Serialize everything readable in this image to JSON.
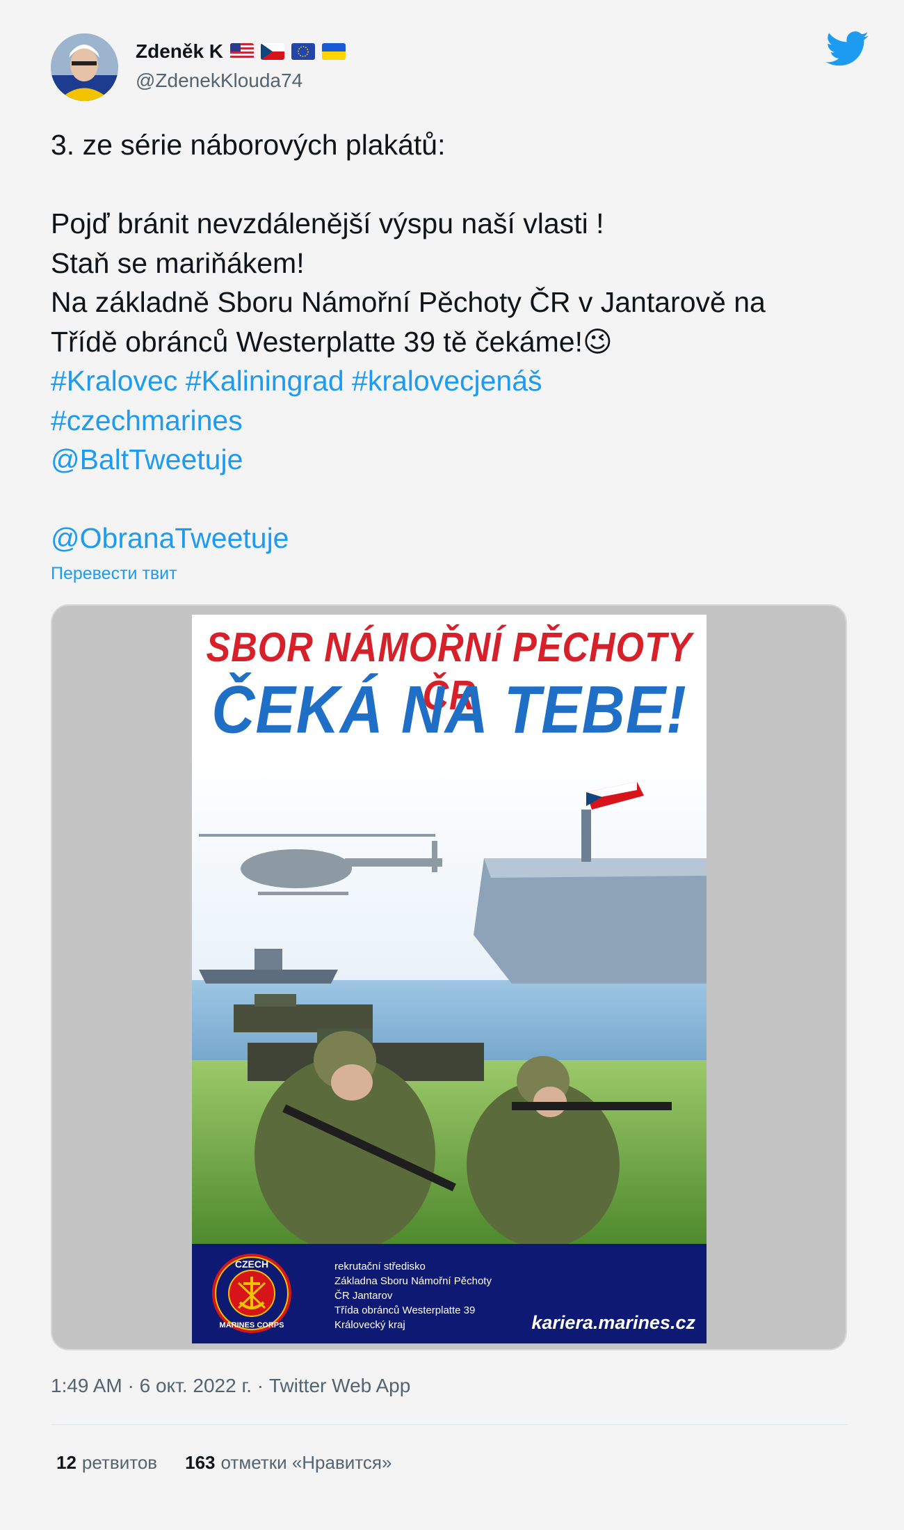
{
  "author": {
    "name": "Zdeněk K",
    "handle": "@ZdenekKlouda74",
    "flags": [
      "us-flag",
      "cz-flag",
      "eu-flag",
      "ua-flag"
    ]
  },
  "tweet": {
    "lines": [
      {
        "text": "3. ze série náborových plakátů:",
        "link": false
      },
      {
        "blank": true
      },
      {
        "text": "Pojď bránit nevzdálenější výspu naší vlasti !",
        "link": false
      },
      {
        "text": "Staň se mariňákem!",
        "link": false
      },
      {
        "text": "Na základně Sboru Námořní Pěchoty ČR v Jantarově na",
        "link": false
      },
      {
        "text": "Třídě obránců Westerplatte 39 tě čekáme!",
        "link": false,
        "emoji": "😉"
      },
      {
        "text": "#Kralovec  #Kaliningrad #kralovecjenáš",
        "link": true
      },
      {
        "text": "#czechmarines",
        "link": true
      },
      {
        "text": "@BaltTweetuje",
        "link": true
      },
      {
        "blank": true
      },
      {
        "text": "@ObranaTweetuje",
        "link": true
      }
    ],
    "translate_label": "Перевести твит"
  },
  "poster": {
    "headline_1": "SBOR NÁMOŘNÍ PĚCHOTY ČR",
    "headline_2": "ČEKÁ NA TEBE!",
    "seal_top": "CZECH",
    "seal_bottom": "MARINES CORPS",
    "recruit_lines": [
      "rekrutační středisko",
      "Základna Sboru Námořní Pěchoty",
      "ČR Jantarov",
      "Třída obránců Westerplatte 39",
      "Královecký kraj"
    ],
    "website": "kariera.marines.cz"
  },
  "meta": "1:49 AM · 6 окт. 2022 г. · Twitter Web App",
  "stats": {
    "retweets_count": "12",
    "retweets_label": "ретвитов",
    "likes_count": "163",
    "likes_label": "отметки «Нравится»"
  },
  "colors": {
    "link": "#1d9bf0",
    "poster_red": "#d6202a",
    "poster_blue": "#1f6fc7",
    "poster_footer": "#0d1973"
  }
}
